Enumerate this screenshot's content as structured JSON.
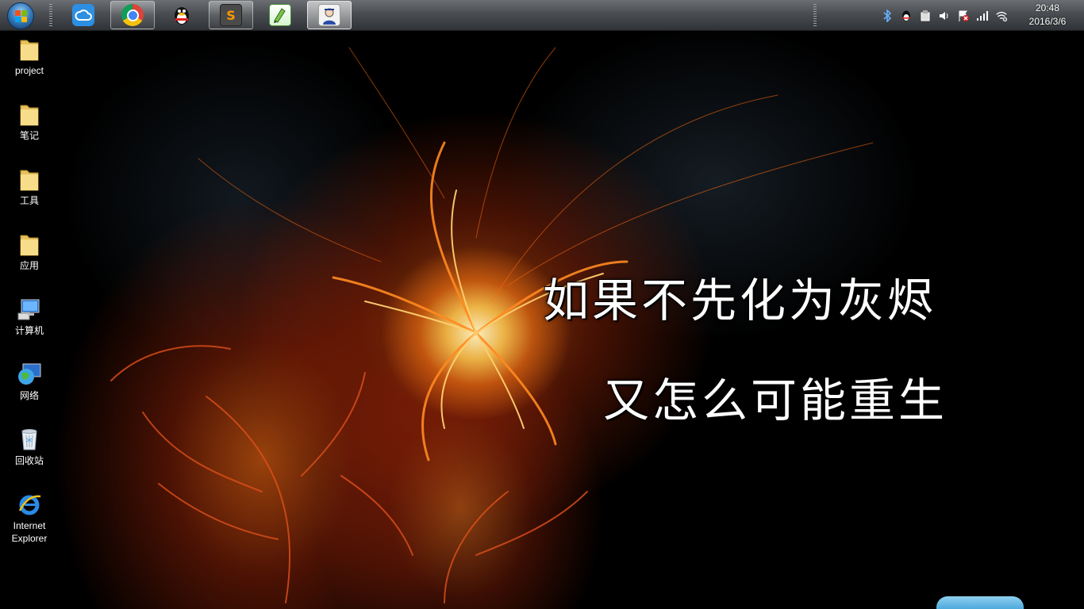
{
  "taskbar": {
    "start_button": "start-orb-icon",
    "pinned": [
      {
        "name": "baidu-netdisk",
        "icon": "cloud-icon",
        "state": "normal"
      },
      {
        "name": "chrome",
        "icon": "chrome-icon",
        "state": "active"
      },
      {
        "name": "qq",
        "icon": "qq-penguin-icon",
        "state": "normal"
      },
      {
        "name": "sublime-text",
        "icon": "sublime-icon",
        "glyph": "S",
        "state": "active"
      },
      {
        "name": "code-editor",
        "icon": "editor-icon",
        "state": "normal"
      },
      {
        "name": "app",
        "icon": "app-icon",
        "state": "current"
      }
    ],
    "tray_icons": [
      "bluetooth-icon",
      "qq-tray-icon",
      "usb-device-icon",
      "volume-icon",
      "flag-error-icon",
      "signal-bars-icon",
      "network-icon"
    ],
    "clock": {
      "time": "20:48",
      "date": "2016/3/6"
    }
  },
  "desktop": {
    "icons": [
      {
        "label": "project",
        "icon": "folder-icon"
      },
      {
        "label": "笔记",
        "icon": "folder-icon"
      },
      {
        "label": "工具",
        "icon": "folder-icon"
      },
      {
        "label": "应用",
        "icon": "folder-icon"
      },
      {
        "label": "计算机",
        "icon": "computer-icon"
      },
      {
        "label": "网络",
        "icon": "network-globe-icon"
      },
      {
        "label": "回收站",
        "icon": "recycle-bin-icon"
      },
      {
        "label": "Internet Explorer",
        "icon": "internet-explorer-icon"
      }
    ]
  },
  "wallpaper": {
    "line1": "如果不先化为灰烬",
    "line2": "又怎么可能重生",
    "colors": {
      "fire": "#ff7a1a",
      "core": "#fff3c0",
      "background": "#000000"
    }
  }
}
